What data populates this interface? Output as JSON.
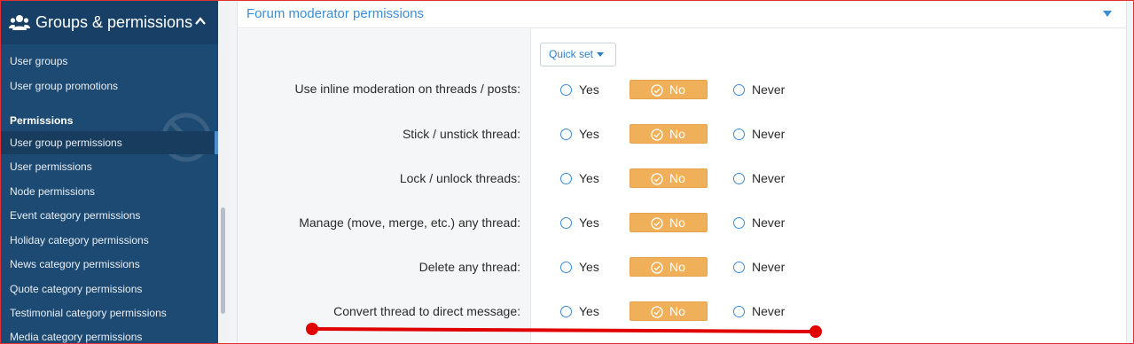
{
  "sidebar": {
    "header_title": "Groups & permissions",
    "items": [
      {
        "label": "User groups"
      },
      {
        "label": "User group promotions"
      }
    ],
    "section_title": "Permissions",
    "permission_items": [
      {
        "label": "User group permissions",
        "active": true
      },
      {
        "label": "User permissions"
      },
      {
        "label": "Node permissions"
      },
      {
        "label": "Event category permissions"
      },
      {
        "label": "Holiday category permissions"
      },
      {
        "label": "News category permissions"
      },
      {
        "label": "Quote category permissions"
      },
      {
        "label": "Testimonial category permissions"
      },
      {
        "label": "Media category permissions"
      }
    ]
  },
  "panel": {
    "title": "Forum moderator permissions",
    "quick_set_label": "Quick set"
  },
  "permissions": [
    {
      "label": "Use inline moderation on threads / posts:",
      "yes": "Yes",
      "no": "No",
      "never": "Never",
      "selected": "No"
    },
    {
      "label": "Stick / unstick thread:",
      "yes": "Yes",
      "no": "No",
      "never": "Never",
      "selected": "No"
    },
    {
      "label": "Lock / unlock threads:",
      "yes": "Yes",
      "no": "No",
      "never": "Never",
      "selected": "No"
    },
    {
      "label": "Manage (move, merge, etc.) any thread:",
      "yes": "Yes",
      "no": "No",
      "never": "Never",
      "selected": "No"
    },
    {
      "label": "Delete any thread:",
      "yes": "Yes",
      "no": "No",
      "never": "Never",
      "selected": "No"
    },
    {
      "label": "Convert thread to direct message:",
      "yes": "Yes",
      "no": "No",
      "never": "Never",
      "selected": "No"
    }
  ],
  "colors": {
    "sidebar_bg": "#1d4a72",
    "accent": "#3b8ed6",
    "selected_no": "#f0b05a",
    "annotation": "#e00000"
  },
  "icons": {
    "header": "users-icon",
    "collapse": "chevron-up-icon",
    "panel_toggle": "caret-down-icon",
    "selected": "check-circle-icon"
  }
}
